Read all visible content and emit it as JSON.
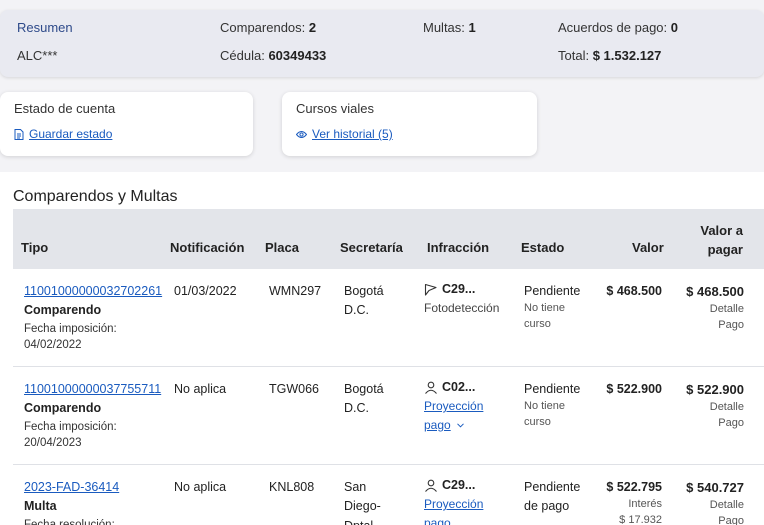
{
  "summary": {
    "title": "Resumen",
    "user": "ALC***",
    "comparendos_label": "Comparendos:",
    "comparendos_value": "2",
    "multas_label": "Multas:",
    "multas_value": "1",
    "acuerdos_label": "Acuerdos de pago:",
    "acuerdos_value": "0",
    "cedula_label": "Cédula:",
    "cedula_value": "60349433",
    "total_label": "Total:",
    "total_value": "$ 1.532.127"
  },
  "cards": {
    "estado": {
      "title": "Estado de cuenta",
      "link": "Guardar estado",
      "icon": "document-icon"
    },
    "cursos": {
      "title": "Cursos viales",
      "link": "Ver historial (5)",
      "icon": "eye-icon"
    }
  },
  "section_title": "Comparendos y Multas",
  "table": {
    "headers": {
      "tipo": "Tipo",
      "notificacion": "Notificación",
      "placa": "Placa",
      "secretaria": "Secretaría",
      "infraccion": "Infracción",
      "estado": "Estado",
      "valor": "Valor",
      "valor_pagar_1": "Valor a",
      "valor_pagar_2": "pagar"
    },
    "rows": [
      {
        "id": "11001000000032702261",
        "tipo": "Comparendo",
        "fecha_label": "Fecha imposición:",
        "fecha": "04/02/2022",
        "notificacion": "01/03/2022",
        "placa": "WMN297",
        "secretaria_1": "Bogotá",
        "secretaria_2": "D.C.",
        "infraccion_code": "C29...",
        "infraccion_icon": "camera-flag-icon",
        "infraccion_sub": "Fotodetección",
        "estado": "Pendiente",
        "estado_sub_1": "No tiene",
        "estado_sub_2": "curso",
        "valor": "$ 468.500",
        "valor_pagar": "$ 468.500",
        "detalle_1": "Detalle",
        "detalle_2": "Pago"
      },
      {
        "id": "11001000000037755711",
        "tipo": "Comparendo",
        "fecha_label": "Fecha imposición:",
        "fecha": "20/04/2023",
        "notificacion": "No aplica",
        "placa": "TGW066",
        "secretaria_1": "Bogotá",
        "secretaria_2": "D.C.",
        "infraccion_code": "C02...",
        "infraccion_icon": "person-icon",
        "infraccion_link_1": "Proyección",
        "infraccion_link_2": "pago",
        "estado": "Pendiente",
        "estado_sub_1": "No tiene",
        "estado_sub_2": "curso",
        "valor": "$ 522.900",
        "valor_pagar": "$ 522.900",
        "detalle_1": "Detalle",
        "detalle_2": "Pago"
      },
      {
        "id": "2023-FAD-36414",
        "tipo": "Multa",
        "fecha_label": "Fecha resolución:",
        "notificacion": "No aplica",
        "placa": "KNL808",
        "secretaria_1": "San",
        "secretaria_2": "Diego-",
        "secretaria_3": "Dptal",
        "infraccion_code": "C29...",
        "infraccion_icon": "person-icon",
        "infraccion_link_1": "Proyección",
        "infraccion_link_2": "pago",
        "estado": "Pendiente",
        "estado_sub_1": "de pago",
        "valor": "$ 522.795",
        "interes_label": "Interés",
        "interes_value": "$ 17.932",
        "valor_pagar": "$ 540.727",
        "detalle_1": "Detalle",
        "detalle_2": "Pago"
      }
    ]
  }
}
